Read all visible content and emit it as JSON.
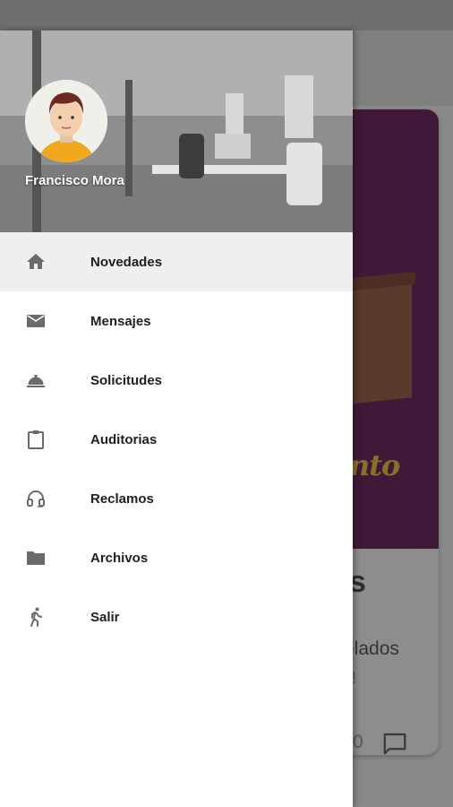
{
  "drawer": {
    "user_name": "Francisco Mora",
    "items": [
      {
        "label": "Novedades",
        "icon": "home-icon",
        "active": true
      },
      {
        "label": "Mensajes",
        "icon": "mail-icon",
        "active": false
      },
      {
        "label": "Solicitudes",
        "icon": "room-service-icon",
        "active": false
      },
      {
        "label": "Auditorias",
        "icon": "clipboard-icon",
        "active": false
      },
      {
        "label": "Reclamos",
        "icon": "headset-icon",
        "active": false
      },
      {
        "label": "Archivos",
        "icon": "folder-icon",
        "active": false
      },
      {
        "label": "Salir",
        "icon": "walking-person-icon",
        "active": false
      }
    ]
  },
  "background": {
    "card_title": "s",
    "card_line1": "elados",
    "card_line2": "s!",
    "card_count": "0",
    "card_logo": "nto"
  },
  "colors": {
    "scrim": "#7a7a7a",
    "card_image": "#3e1a38",
    "active_item_bg": "#efefef",
    "icon": "#6b6b6b"
  }
}
